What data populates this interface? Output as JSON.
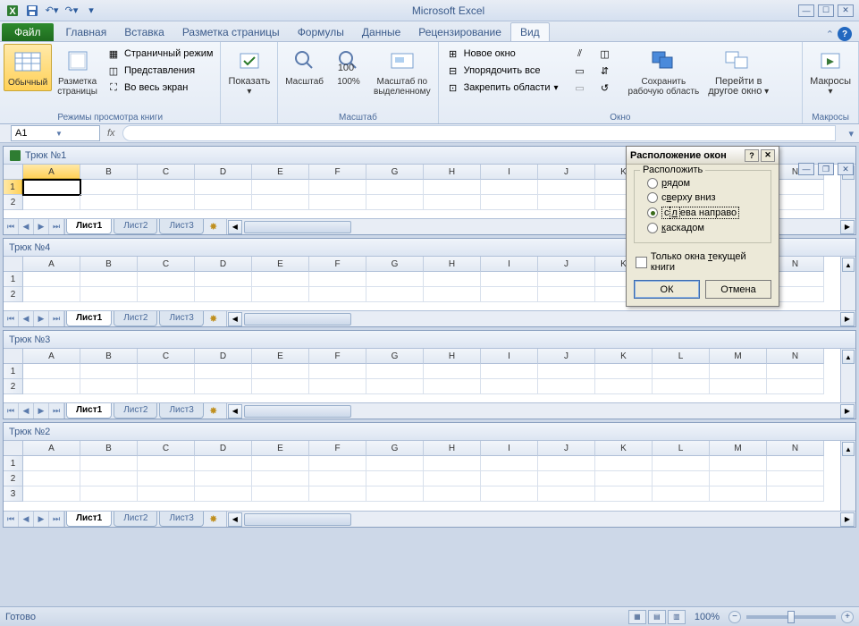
{
  "app": {
    "title": "Microsoft Excel"
  },
  "qat": {
    "save": "save-icon",
    "undo": "undo-icon",
    "redo": "redo-icon"
  },
  "ribbon_tabs": {
    "file": "Файл",
    "home": "Главная",
    "insert": "Вставка",
    "page_layout": "Разметка страницы",
    "formulas": "Формулы",
    "data": "Данные",
    "review": "Рецензирование",
    "view": "Вид",
    "active": "view"
  },
  "ribbon_view": {
    "group_views": {
      "label": "Режимы просмотра книги",
      "normal": "Обычный",
      "page_layout": "Разметка\nстраницы",
      "page_break": "Страничный режим",
      "custom_views": "Представления",
      "full_screen": "Во весь экран"
    },
    "group_show": {
      "label": "",
      "show": "Показать"
    },
    "group_zoom": {
      "label": "Масштаб",
      "zoom": "Масштаб",
      "p100": "100%",
      "to_selection": "Масштаб по\nвыделенному"
    },
    "group_window": {
      "label": "Окно",
      "new_window": "Новое окно",
      "arrange_all": "Упорядочить все",
      "freeze": "Закрепить области",
      "save_workspace": "Сохранить\nрабочую область",
      "switch_windows": "Перейти в\nдругое окно"
    },
    "group_macros": {
      "label": "Макросы",
      "macros": "Макросы"
    }
  },
  "formula_bar": {
    "name_box": "A1",
    "fx": "fx",
    "formula": ""
  },
  "workbooks": [
    {
      "title": "Трюк №1",
      "sheets": [
        "Лист1",
        "Лист2",
        "Лист3"
      ],
      "active_sheet": 0,
      "selected_cell": "A1",
      "rows_shown": 2
    },
    {
      "title": "Трюк №4",
      "sheets": [
        "Лист1",
        "Лист2",
        "Лист3"
      ],
      "active_sheet": 0,
      "rows_shown": 2
    },
    {
      "title": "Трюк №3",
      "sheets": [
        "Лист1",
        "Лист2",
        "Лист3"
      ],
      "active_sheet": 0,
      "rows_shown": 2
    },
    {
      "title": "Трюк №2",
      "sheets": [
        "Лист1",
        "Лист2",
        "Лист3"
      ],
      "active_sheet": 0,
      "rows_shown": 3
    }
  ],
  "columns": [
    "A",
    "B",
    "C",
    "D",
    "E",
    "F",
    "G",
    "H",
    "I",
    "J",
    "K",
    "L",
    "M",
    "N"
  ],
  "dialog": {
    "title": "Расположение окон",
    "group_label": "Расположить",
    "options": {
      "tiled": "рядом",
      "horizontal": "сверху вниз",
      "vertical": "слева направо",
      "cascade": "каскадом"
    },
    "selected": "vertical",
    "checkbox": "Только окна текущей книги",
    "ok": "ОК",
    "cancel": "Отмена"
  },
  "status": {
    "ready": "Готово",
    "zoom": "100%"
  }
}
